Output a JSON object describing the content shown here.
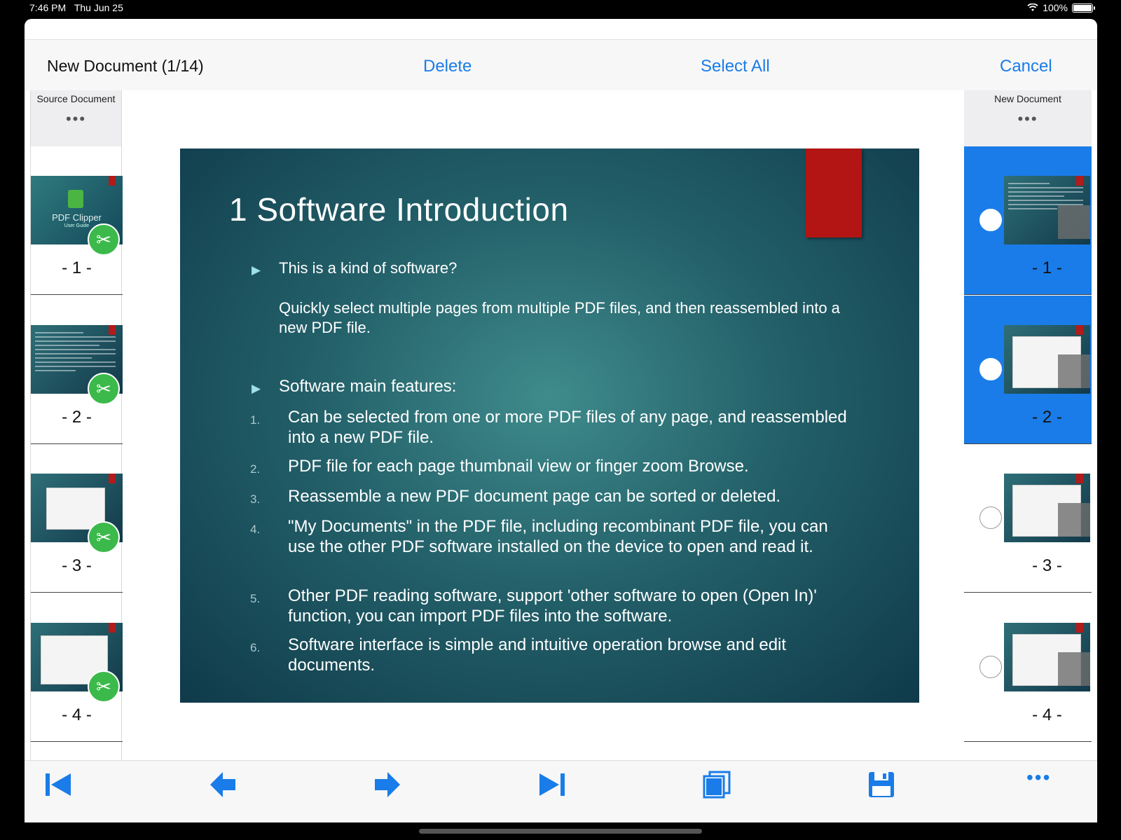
{
  "status": {
    "time": "7:46 PM",
    "date": "Thu Jun 25",
    "battery": "100%"
  },
  "navbar": {
    "title": "New Document (1/14)",
    "delete_label": "Delete",
    "select_all_label": "Select All",
    "cancel_label": "Cancel"
  },
  "left_panel": {
    "header": "Source Document",
    "more": "•••",
    "pages": [
      {
        "number": "- 1 -",
        "thumb_title": "PDF Clipper",
        "thumb_subtitle": "User Guide"
      },
      {
        "number": "- 2 -"
      },
      {
        "number": "- 3 -"
      },
      {
        "number": "- 4 -"
      }
    ]
  },
  "right_panel": {
    "header": "New Document",
    "more": "•••",
    "pages": [
      {
        "number": "- 1 -",
        "selected": true
      },
      {
        "number": "- 2 -",
        "selected": true
      },
      {
        "number": "- 3 -",
        "selected": false
      },
      {
        "number": "- 4 -",
        "selected": false
      }
    ]
  },
  "slide": {
    "title": "1 Software Introduction",
    "q1": "This is a kind of software?",
    "q1_answer": "Quickly select multiple pages from multiple PDF files, and then reassembled into a new PDF file.",
    "q2": "Software main features:",
    "features": [
      {
        "num": "1.",
        "text": "Can be selected from one or more PDF files of any page, and reassembled into a new PDF file."
      },
      {
        "num": "2.",
        "text": "PDF file for each page thumbnail view or finger zoom Browse."
      },
      {
        "num": "3.",
        "text": "Reassemble a new PDF document page can be sorted or deleted."
      },
      {
        "num": "4.",
        "text": "\"My Documents\" in the PDF file, including recombinant PDF file, you can use the other PDF software installed on the device to open and read it."
      },
      {
        "num": "5.",
        "text": "Other PDF reading software, support 'other software to open (Open In)' function, you can import PDF files into the software."
      },
      {
        "num": "6.",
        "text": "Software interface is simple and intuitive operation browse and edit documents."
      }
    ]
  },
  "toolbar": {
    "icons": [
      "first-page-icon",
      "previous-icon",
      "next-icon",
      "last-page-icon",
      "pages-icon",
      "save-icon",
      "more-icon"
    ],
    "more": "•••"
  },
  "colors": {
    "accent": "#1a7ce8",
    "slide_bg": "#236069",
    "red": "#b31414",
    "scissor_green": "#3cb94b"
  }
}
